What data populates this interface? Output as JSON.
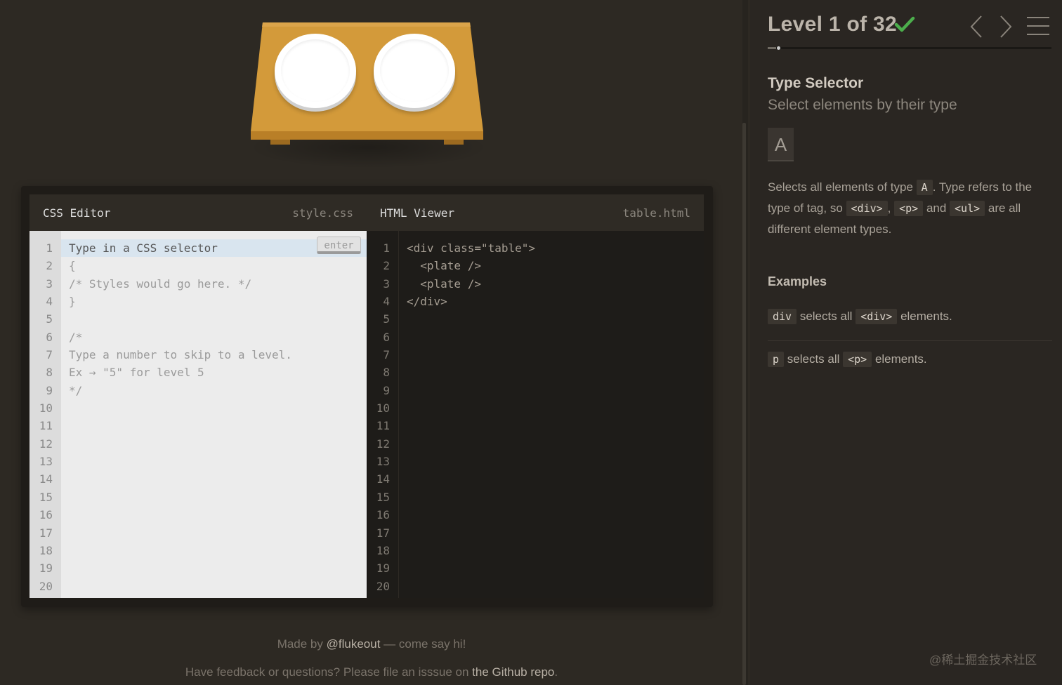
{
  "editor": {
    "css_title": "CSS Editor",
    "css_file": "style.css",
    "html_title": "HTML Viewer",
    "html_file": "table.html",
    "input_placeholder": "Type in a CSS selector",
    "enter_label": "enter",
    "css_lines": [
      "{",
      "/* Styles would go here. */",
      "}",
      "",
      "/*",
      "Type a number to skip to a level.",
      "Ex → \"5\" for level 5",
      "*/"
    ],
    "html_lines": [
      "<div class=\"table\">",
      "  <plate />",
      "  <plate />",
      "</div>"
    ],
    "line_count": 20
  },
  "footer": {
    "made_by_prefix": "Made by ",
    "author": "@flukeout",
    "made_by_suffix": " — come say hi!",
    "feedback_prefix": "Have feedback or questions? Please file an isssue on ",
    "repo_link": "the Github repo",
    "feedback_suffix": "."
  },
  "sidebar": {
    "level_title": "Level 1 of 32",
    "progress": 0.03,
    "selector_name": "Type Selector",
    "selector_title": "Select elements by their type",
    "syntax": "A",
    "hint": {
      "p1": "Selects all elements of type ",
      "t1": "A",
      "p2": ". Type refers to the type of tag, so ",
      "t2": "<div>",
      "p3": ", ",
      "t3": "<p>",
      "p4": " and ",
      "t4": "<ul>",
      "p5": " are all different element types."
    },
    "examples_title": "Examples",
    "examples": [
      {
        "tag1": "div",
        "text1": " selects all ",
        "tag2": "<div>",
        "text2": " elements."
      },
      {
        "tag1": "p",
        "text1": " selects all ",
        "tag2": "<p>",
        "text2": " elements."
      }
    ]
  },
  "watermark": "@稀土掘金技术社区",
  "colors": {
    "check": "#4cae4c",
    "table": "#d39a3a"
  }
}
